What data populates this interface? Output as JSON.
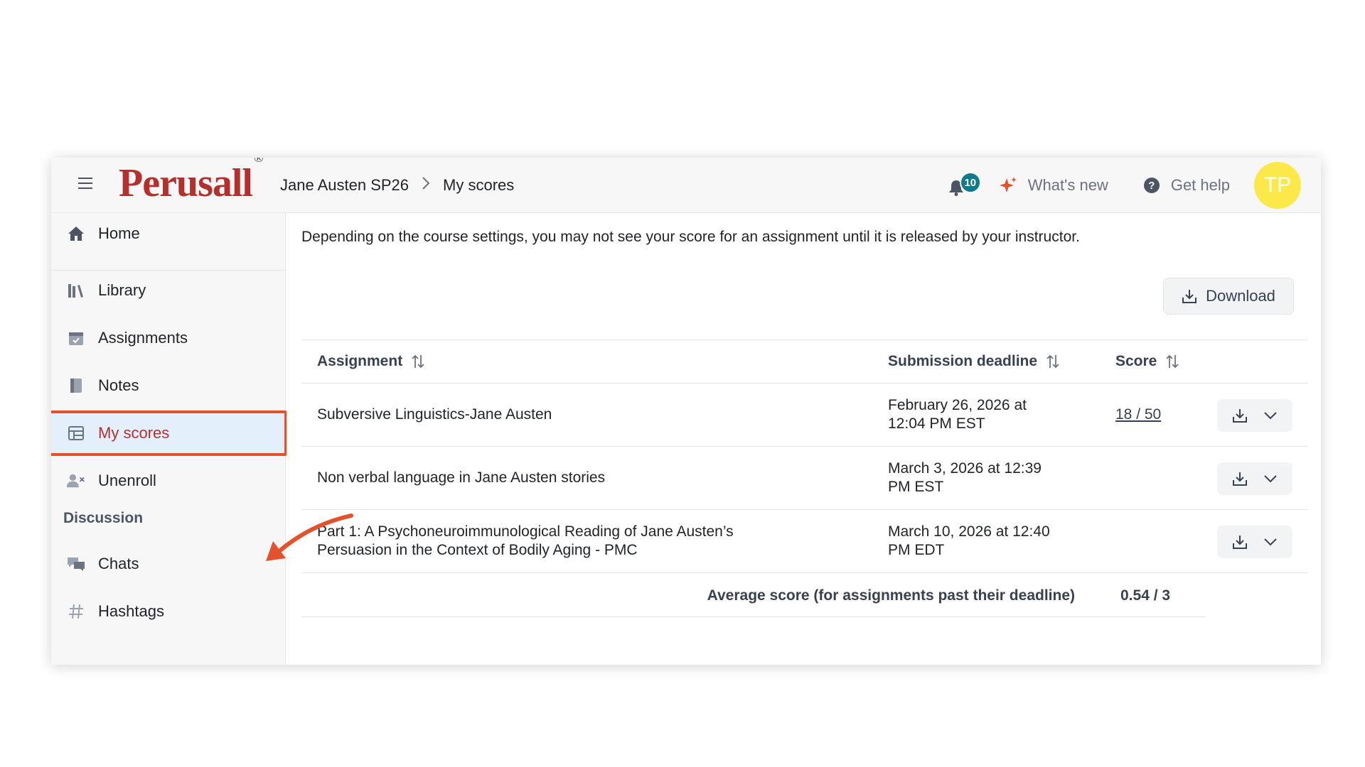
{
  "app": {
    "logo": "Perusall",
    "logo_mark": "®"
  },
  "breadcrumb": {
    "course": "Jane Austen SP26",
    "page": "My scores"
  },
  "header": {
    "notifications_count": "10",
    "whats_new": "What's new",
    "get_help": "Get help",
    "help_glyph": "?",
    "avatar_initials": "TP"
  },
  "sidebar": {
    "items": [
      {
        "label": "Home",
        "icon": "home-icon"
      },
      {
        "label": "Library",
        "icon": "library-icon"
      },
      {
        "label": "Assignments",
        "icon": "calendar-check-icon"
      },
      {
        "label": "Notes",
        "icon": "notebook-icon"
      },
      {
        "label": "My scores",
        "icon": "scores-table-icon",
        "active": true
      },
      {
        "label": "Unenroll",
        "icon": "user-remove-icon"
      }
    ],
    "discussion_label": "Discussion",
    "discussion_items": [
      {
        "label": "Chats",
        "icon": "chat-bubbles-icon"
      },
      {
        "label": "Hashtags",
        "icon": "hashtag-icon"
      }
    ]
  },
  "main": {
    "notice": "Depending on the course settings, you may not see your score for an assignment until it is released by your instructor.",
    "download_label": "Download",
    "table": {
      "columns": [
        "Assignment",
        "Submission deadline",
        "Score"
      ],
      "rows": [
        {
          "assignment": "Subversive Linguistics-Jane Austen",
          "deadline_line1": "February 26, 2026 at",
          "deadline_line2": "12:04 PM EST",
          "score": "18 / 50"
        },
        {
          "assignment": "Non verbal language in Jane Austen stories",
          "deadline_line1": "March 3, 2026 at 12:39",
          "deadline_line2": "PM EST",
          "score": ""
        },
        {
          "assignment_line1": "Part 1: A Psychoneuroimmunological Reading of Jane Austen’s",
          "assignment_line2": "Persuasion in the Context of Bodily Aging - PMC",
          "deadline_line1": "March 10, 2026 at 12:40",
          "deadline_line2": "PM EDT",
          "score": ""
        }
      ],
      "average_label": "Average score (for assignments past their deadline)",
      "average_value": "0.54 / 3"
    }
  },
  "colors": {
    "brand": "#b5302c",
    "annotation": "#e4522c",
    "badge": "#0e7a8a",
    "avatar": "#fbe94a",
    "active_bg": "#e3f0fb"
  }
}
